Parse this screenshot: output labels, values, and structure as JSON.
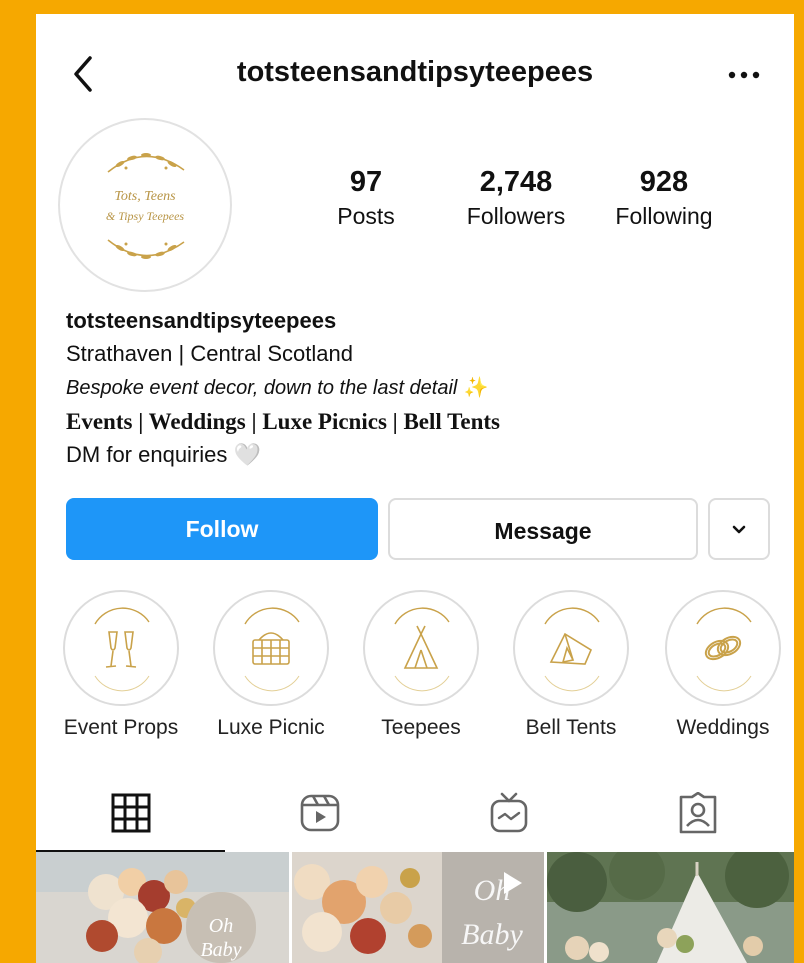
{
  "header": {
    "username": "totsteensandtipsyteepees"
  },
  "profile": {
    "avatar_text_line1": "Tots, Teens",
    "avatar_text_line2": "& Tipsy Teepees",
    "stats": [
      {
        "value": "97",
        "label": "Posts"
      },
      {
        "value": "2,748",
        "label": "Followers"
      },
      {
        "value": "928",
        "label": "Following"
      }
    ]
  },
  "bio": {
    "name": "totsteensandtipsyteepees",
    "location": "Strathaven | Central Scotland",
    "tagline": "Bespoke event decor, down to the last detail",
    "tagline_emoji": "✨",
    "services": "Events | Weddings | Luxe Picnics | Bell Tents",
    "cta": "DM for enquiries",
    "cta_emoji": "🤍"
  },
  "actions": {
    "follow": "Follow",
    "message": "Message"
  },
  "highlights": [
    {
      "label": "Event Props",
      "icon": "champagne-glasses-icon"
    },
    {
      "label": "Luxe Picnic",
      "icon": "picnic-basket-icon"
    },
    {
      "label": "Teepees",
      "icon": "teepee-icon"
    },
    {
      "label": "Bell Tents",
      "icon": "bell-tent-icon"
    },
    {
      "label": "Weddings",
      "icon": "wedding-rings-icon"
    }
  ],
  "tabs": [
    {
      "name": "grid",
      "icon": "grid-icon",
      "active": true
    },
    {
      "name": "reels",
      "icon": "reels-icon",
      "active": false
    },
    {
      "name": "igtv",
      "icon": "igtv-icon",
      "active": false
    },
    {
      "name": "tagged",
      "icon": "tagged-icon",
      "active": false
    }
  ],
  "colors": {
    "background": "#F6A800",
    "follow_button": "#1E96F8",
    "gold_accent": "#C9A24A"
  }
}
